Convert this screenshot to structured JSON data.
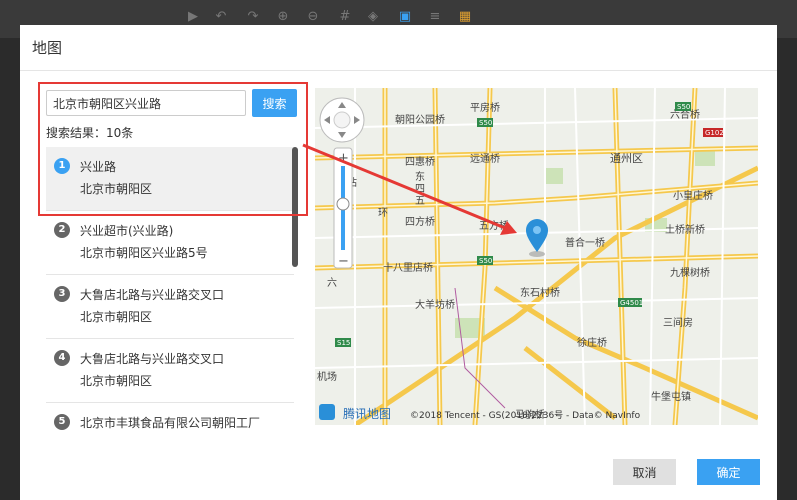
{
  "toolbar": {
    "icons": [
      "play-icon",
      "undo-icon",
      "redo-icon",
      "zoom-in-icon",
      "zoom-out-icon",
      "grid-icon",
      "layers-icon",
      "image-icon",
      "list-icon",
      "palette-icon"
    ]
  },
  "dialog": {
    "title": "地图"
  },
  "search": {
    "value": "北京市朝阳区兴业路",
    "button": "搜索",
    "result_count": "搜索结果：10条"
  },
  "results": [
    {
      "num": "1",
      "name": "兴业路",
      "address": "北京市朝阳区"
    },
    {
      "num": "2",
      "name": "兴业超市(兴业路)",
      "address": "北京市朝阳区兴业路5号"
    },
    {
      "num": "3",
      "name": "大鲁店北路与兴业路交叉口",
      "address": "北京市朝阳区"
    },
    {
      "num": "4",
      "name": "大鲁店北路与兴业路交叉口",
      "address": "北京市朝阳区"
    },
    {
      "num": "5",
      "name": "北京市丰琪食品有限公司朝阳工厂",
      "address": ""
    }
  ],
  "map": {
    "labels": {
      "pingfang": "平房桥",
      "chaoyang_park": "朝阳公园桥",
      "sihui_qiao": "四惠桥",
      "yuanqiao": "远通桥",
      "tongzhou": "通州区",
      "dongsi": "东",
      "sifang": "四方桥",
      "wufang": "五方桥",
      "huan": "环",
      "sihuan": "四",
      "wu": "五",
      "liu": "六",
      "shibalidian": "十八里店桥",
      "dayang": "大羊坊桥",
      "dongshicun": "东石村桥",
      "xukan": "徐庄桥",
      "jiuguanqiao": "九棵树桥",
      "tushan": "土桥新桥",
      "xiaohuangzhuang": "小皇庄桥",
      "puqiao": "普合一桥",
      "liuhe": "六合桥",
      "sanjianfang": "三间房",
      "niutun": "牛堡屯镇",
      "maqiao": "马驹桥",
      "jichang": "机场",
      "zhan": "站"
    },
    "shields": [
      "S50",
      "G102",
      "S50",
      "G4501",
      "S15",
      "S50"
    ],
    "logo": "腾讯地图",
    "copyright": "©2018 Tencent - GS(2018)2236号 - Data© NavInfo",
    "zoom_in": "+",
    "zoom_out": "−"
  },
  "footer": {
    "cancel": "取消",
    "confirm": "确定"
  },
  "colors": {
    "accent": "#3aa1f2",
    "highlight": "#e53935",
    "pin": "#2a8fd8"
  }
}
